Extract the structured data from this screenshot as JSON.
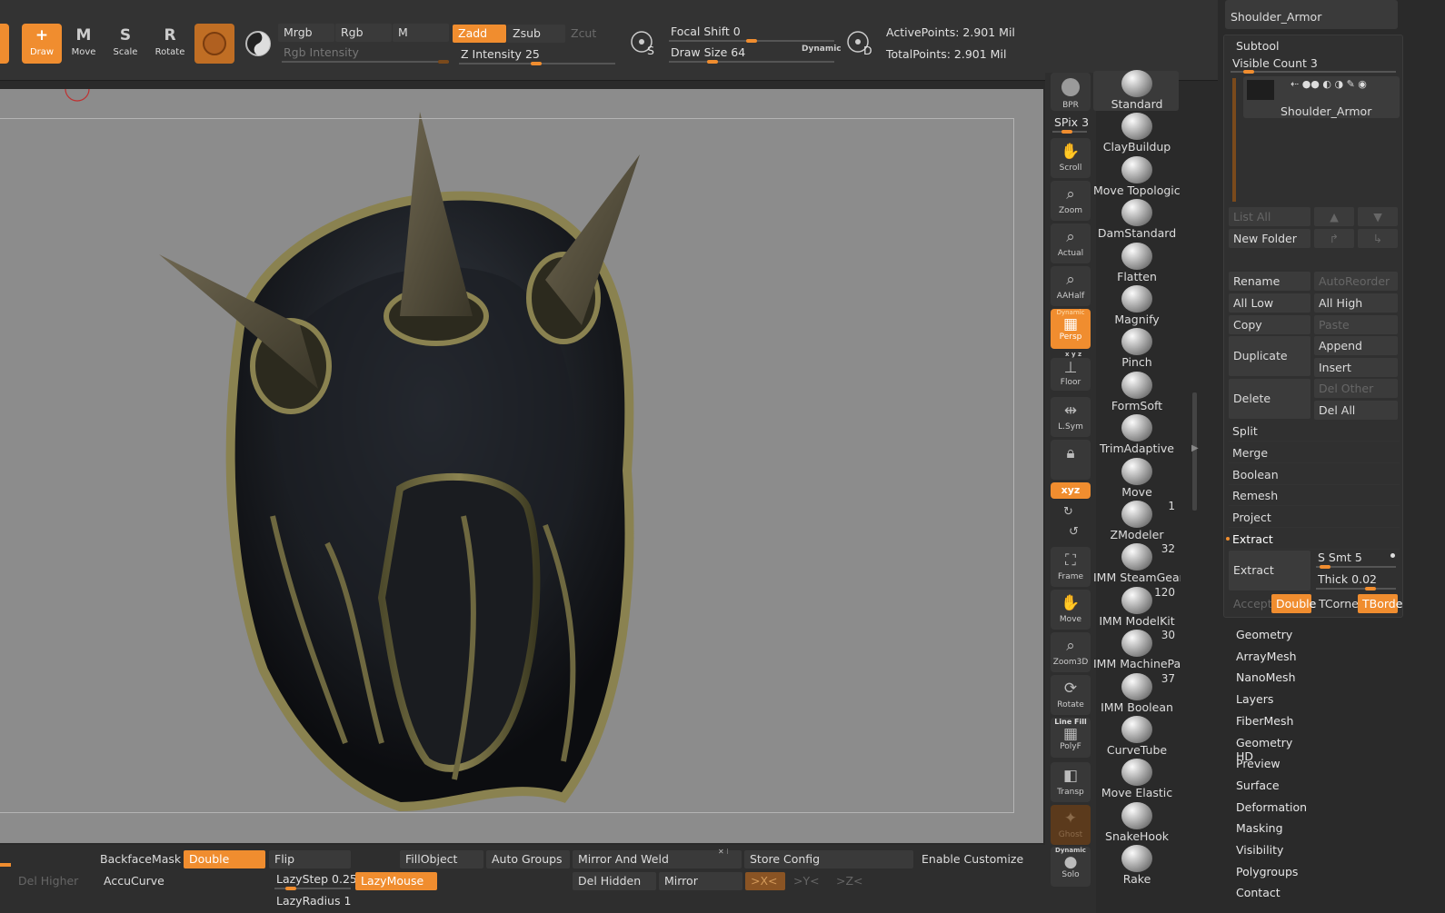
{
  "toolbar": {
    "tools": [
      {
        "key": "draw",
        "letter": "+",
        "label": "Draw"
      },
      {
        "key": "move",
        "letter": "M",
        "label": "Move"
      },
      {
        "key": "scale",
        "letter": "S",
        "label": "Scale"
      },
      {
        "key": "rotate",
        "letter": "R",
        "label": "Rotate"
      }
    ],
    "mrgb": "Mrgb",
    "rgb": "Rgb",
    "m": "M",
    "zadd": "Zadd",
    "zsub": "Zsub",
    "zcut": "Zcut",
    "rgb_intensity_label": "Rgb Intensity",
    "z_intensity_label": "Z Intensity",
    "z_intensity_value": "25",
    "focal_shift_label": "Focal Shift",
    "focal_shift_value": "0",
    "draw_size_label": "Draw Size",
    "draw_size_value": "64",
    "dynamic_label": "Dynamic",
    "s_label": "S",
    "d_label": "D",
    "active_points": "ActivePoints: 2.901 Mil",
    "total_points": "TotalPoints: 2.901 Mil"
  },
  "rightbar": {
    "bpr": "BPR",
    "spix_label": "SPix",
    "spix_value": "3",
    "buttons": [
      {
        "key": "scroll",
        "label": "Scroll"
      },
      {
        "key": "zoom",
        "label": "Zoom"
      },
      {
        "key": "actual",
        "label": "Actual"
      },
      {
        "key": "aahalf",
        "label": "AAHalf"
      },
      {
        "key": "persp",
        "label": "Persp"
      },
      {
        "key": "floor",
        "label": "Floor"
      },
      {
        "key": "lsym",
        "label": "L.Sym"
      },
      {
        "key": "frame",
        "label": "Frame"
      },
      {
        "key": "move3d",
        "label": "Move"
      },
      {
        "key": "zoom3d",
        "label": "Zoom3D"
      },
      {
        "key": "rotate3d",
        "label": "Rotate"
      },
      {
        "key": "polyf",
        "label": "PolyF"
      },
      {
        "key": "transp",
        "label": "Transp"
      },
      {
        "key": "ghost",
        "label": "Ghost"
      },
      {
        "key": "solo",
        "label": "Solo"
      }
    ],
    "persp_sub": "Dynamic",
    "xyz_small": "x y z",
    "xyz": "xyz",
    "linefill": "Line Fill",
    "solo_sub": "Dynamic"
  },
  "brushes": [
    {
      "name": "Standard",
      "count": ""
    },
    {
      "name": "ClayBuildup",
      "count": ""
    },
    {
      "name": "Move Topologica",
      "count": ""
    },
    {
      "name": "DamStandard",
      "count": ""
    },
    {
      "name": "Flatten",
      "count": ""
    },
    {
      "name": "Magnify",
      "count": ""
    },
    {
      "name": "Pinch",
      "count": ""
    },
    {
      "name": "FormSoft",
      "count": ""
    },
    {
      "name": "TrimAdaptive",
      "count": ""
    },
    {
      "name": "Move",
      "count": ""
    },
    {
      "name": "ZModeler",
      "count": "1"
    },
    {
      "name": "IMM SteamGear",
      "count": "32"
    },
    {
      "name": "IMM ModelKit",
      "count": "120"
    },
    {
      "name": "IMM MachinePa",
      "count": "30"
    },
    {
      "name": "IMM Boolean",
      "count": "37"
    },
    {
      "name": "CurveTube",
      "count": ""
    },
    {
      "name": "Move Elastic",
      "count": ""
    },
    {
      "name": "SnakeHook",
      "count": ""
    },
    {
      "name": "Rake",
      "count": ""
    }
  ],
  "subtool": {
    "top_thumb_name": "Shoulder_Armor",
    "title": "Subtool",
    "visible_count_label": "Visible Count",
    "visible_count_value": "3",
    "item_name": "Shoulder_Armor",
    "list_all": "List All",
    "new_folder": "New Folder",
    "rename": "Rename",
    "autoreorder": "AutoReorder",
    "all_low": "All Low",
    "all_high": "All High",
    "copy": "Copy",
    "paste": "Paste",
    "duplicate": "Duplicate",
    "append": "Append",
    "insert": "Insert",
    "delete": "Delete",
    "del_other": "Del Other",
    "del_all": "Del All",
    "rows": [
      "Split",
      "Merge",
      "Boolean",
      "Remesh",
      "Project"
    ],
    "extract_header": "Extract",
    "extract_button": "Extract",
    "s_smt_label": "S Smt",
    "s_smt_value": "5",
    "thick_label": "Thick",
    "thick_value": "0.02",
    "accept": "Accept",
    "double": "Double",
    "tcorne": "TCorne",
    "tborde": "TBorde"
  },
  "menus": [
    "Geometry",
    "ArrayMesh",
    "NanoMesh",
    "Layers",
    "FiberMesh",
    "Geometry HD",
    "Preview",
    "Surface",
    "Deformation",
    "Masking",
    "Visibility",
    "Polygroups",
    "Contact"
  ],
  "bottombar": {
    "backfacemask": "BackfaceMask",
    "double": "Double",
    "flip": "Flip",
    "fillobject": "FillObject",
    "auto_groups": "Auto Groups",
    "mirror_and_weld": "Mirror And Weld",
    "store_config": "Store Config",
    "enable_customize": "Enable Customize",
    "del_higher": "Del Higher",
    "accucurve": "AccuCurve",
    "lazystep_label": "LazyStep",
    "lazystep_value": "0.25",
    "lazymouse": "LazyMouse",
    "del_hidden": "Del Hidden",
    "mirror": "Mirror",
    "x_axis": ">X<",
    "y_axis": ">Y<",
    "z_axis": ">Z<",
    "lazyradius_label": "LazyRadius",
    "lazyradius_value": "1"
  },
  "colors": {
    "accent": "#f08d2f",
    "viewport_bg": "#8c8c8c",
    "panel_bg": "#2a2a2a"
  }
}
